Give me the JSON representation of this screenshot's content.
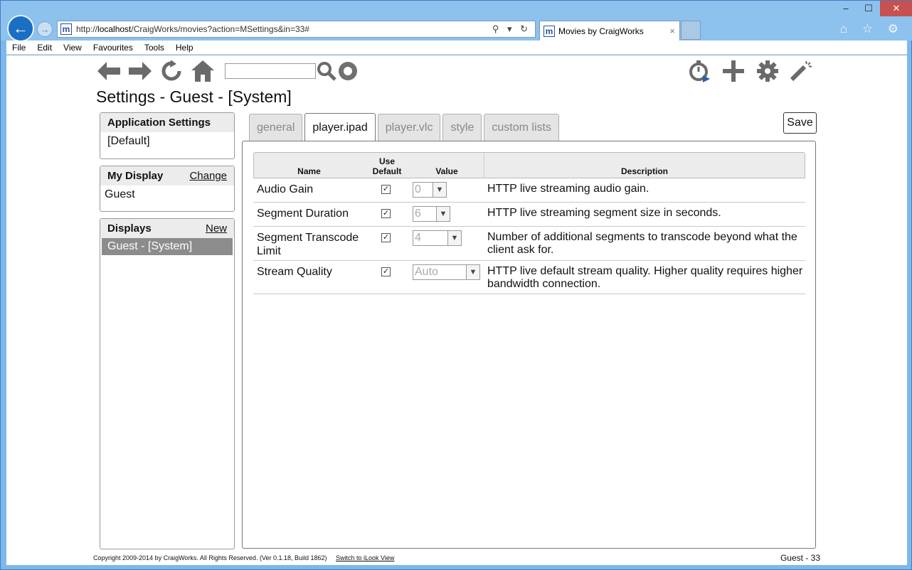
{
  "browser": {
    "url_prefix": "http://",
    "url_host": "localhost",
    "url_path": "/CraigWorks/movies?action=MSettings&in=33#",
    "favicon_letter": "m",
    "tab_title": "Movies by CraigWorks",
    "tab_close": "×",
    "address_icons": "⚲ ▾ ↻",
    "win_min": "–",
    "win_max": "☐",
    "win_close": "✕",
    "ie_icons": "⌂ ☆ ⚙",
    "back_glyph": "←",
    "fwd_glyph": "→"
  },
  "menu": [
    "File",
    "Edit",
    "View",
    "Favourites",
    "Tools",
    "Help"
  ],
  "toolbar": {
    "back_icon": "back-arrow",
    "forward_icon": "forward-arrow",
    "refresh_icon": "refresh",
    "home_icon": "home",
    "search_placeholder": "",
    "right_icons": [
      "timer",
      "add",
      "settings",
      "wand"
    ]
  },
  "page": {
    "title": "Settings - Guest - [System]"
  },
  "sidebar": {
    "app_settings": {
      "heading": "Application Settings",
      "value": "[Default]"
    },
    "my_display": {
      "heading": "My Display",
      "action": "Change",
      "value": "Guest"
    },
    "displays": {
      "heading": "Displays",
      "action": "New",
      "selected": "Guest - [System]"
    }
  },
  "tabs": [
    {
      "label": "general",
      "active": false
    },
    {
      "label": "player.ipad",
      "active": true
    },
    {
      "label": "player.vlc",
      "active": false
    },
    {
      "label": "style",
      "active": false
    },
    {
      "label": "custom lists",
      "active": false
    }
  ],
  "save_label": "Save",
  "table": {
    "headers": {
      "name": "Name",
      "use_default_1": "Use",
      "use_default_2": "Default",
      "value": "Value",
      "description": "Description"
    },
    "rows": [
      {
        "name": "Audio Gain",
        "use_default": true,
        "value": "0",
        "description": "HTTP live streaming audio gain."
      },
      {
        "name": "Segment Duration",
        "use_default": true,
        "value": "6",
        "description": "HTTP live streaming segment size in seconds."
      },
      {
        "name": "Segment Transcode Limit",
        "use_default": true,
        "value": "4",
        "description": "Number of additional segments to transcode beyond what the client ask for."
      },
      {
        "name": "Stream Quality",
        "use_default": true,
        "value": "Auto",
        "description": "HTTP live default stream quality. Higher quality requires higher bandwidth connection."
      }
    ]
  },
  "footer": {
    "copyright": "Copyright 2009-2014 by CraigWorks. All Rights Reserved. (Ver 0.1.18, Build 1862)",
    "link": "Switch to iLook View",
    "status": "Guest - 33"
  },
  "colors": {
    "frame": "#7eb8eb",
    "back_button": "#1a6fc4",
    "selected_display": "#8c8c8c"
  }
}
